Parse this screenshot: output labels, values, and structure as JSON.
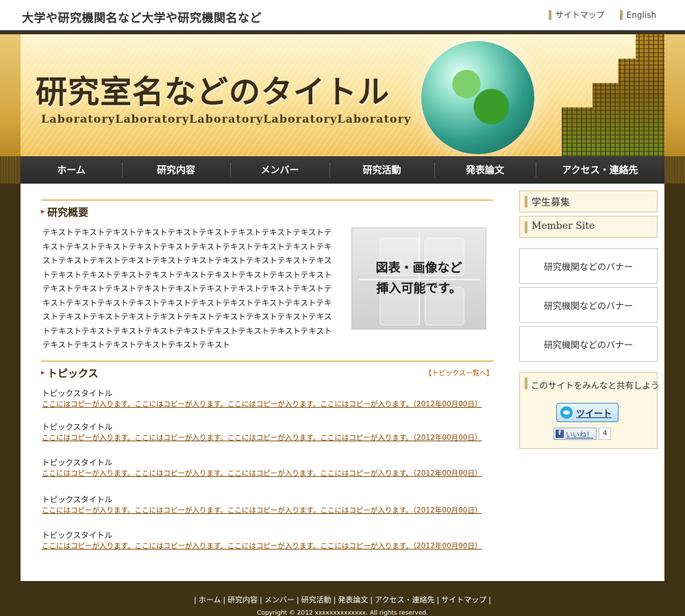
{
  "topbar": {
    "institution": "大学や研究機関名など大学や研究機関名など",
    "links": [
      "サイトマップ",
      "English"
    ]
  },
  "header": {
    "title": "研究室名などのタイトル",
    "subtitle": "LaboratoryLaboratoryLaboratoryLaboratoryLaboratory"
  },
  "nav": {
    "items": [
      "ホーム",
      "研究内容",
      "メンバー",
      "研究活動",
      "発表論文",
      "アクセス・連絡先"
    ]
  },
  "overview": {
    "heading": "研究概要",
    "text": "テキストテキストテキストテキストテキストテキストテキストテキストテキストテキストテキストテキストテキストテキストテキストテキストテキストテキストテキストテキストテキストテキストテキストテキストテキストテキストテキストテキストテキストテキストテキストテキストテキストテキストテキストテキストテキストテキストテキストテキストテキストテキストテキストテキストテキストテキストテキストテキストテキストテキストテキストテキストテキストテキストテキストテキストテキストテキストテキストテキストテキストテキストテキストテキストテキストテキストテキストテキストテキストテキストテキストテキストテキストテキストテキストテキストテキストテキストテキストテキスト",
    "figure_caption": "図表・画像など\n挿入可能です。"
  },
  "topics": {
    "heading": "トピックス",
    "more_link": "【トピックス一覧へ】",
    "items": [
      {
        "title": "トピックスタイトル",
        "body": "ここにはコピーが入ります。ここにはコピーが入ります。ここにはコピーが入ります。ここにはコピーが入ります。（2012年00月00日）"
      },
      {
        "title": "トピックスタイトル",
        "body": "ここにはコピーが入ります。ここにはコピーが入ります。ここにはコピーが入ります。ここにはコピーが入ります。（2012年00月00日）"
      },
      {
        "title": "トピックスタイトル",
        "body": "ここにはコピーが入ります。ここにはコピーが入ります。ここにはコピーが入ります。ここにはコピーが入ります。（2012年00月00日）"
      },
      {
        "title": "トピックスタイトル",
        "body": "ここにはコピーが入ります。ここにはコピーが入ります。ここにはコピーが入ります。ここにはコピーが入ります。（2012年00月00日）"
      },
      {
        "title": "トピックスタイトル",
        "body": "ここにはコピーが入ります。ここにはコピーが入ります。ここにはコピーが入ります。ここにはコピーが入ります。（2012年00月00日）"
      }
    ]
  },
  "sidebar": {
    "links": [
      "学生募集",
      "Member Site"
    ],
    "banners": [
      "研究機関などのバナー",
      "研究機関などのバナー",
      "研究機関などのバナー"
    ],
    "share": {
      "heading": "このサイトをみんなと共有しよう",
      "tweet_label": "ツイート",
      "like_label": "いいね！",
      "like_count": "4"
    }
  },
  "footer": {
    "links": [
      "ホーム",
      "研究内容",
      "メンバー",
      "研究活動",
      "発表論文",
      "アクセス・連絡先",
      "サイトマップ"
    ],
    "copyright": "Copyright © 2012 xxxxxxxxxxxxxx. All rights reserved."
  },
  "colors": {
    "accent_gold": "#e2c36b",
    "nav_bg": "#2f2f2f",
    "page_bg": "#3f3314",
    "link_brown": "#8a4a00"
  }
}
